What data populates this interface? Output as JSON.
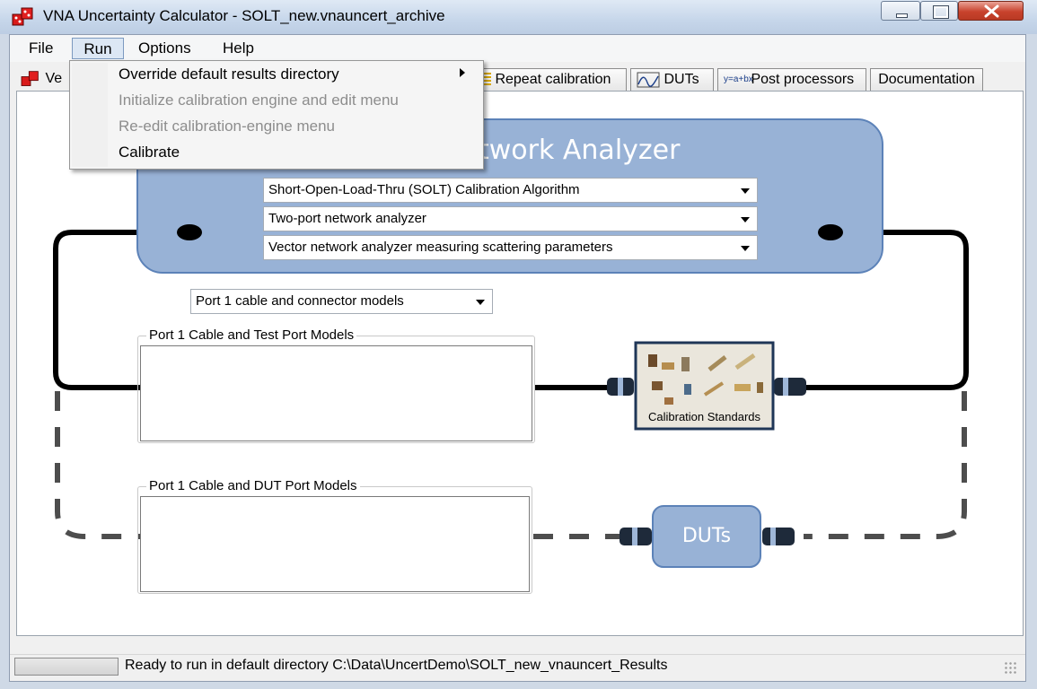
{
  "window": {
    "title": "VNA Uncertainty Calculator - SOLT_new.vnauncert_archive"
  },
  "menubar": {
    "items": [
      "File",
      "Run",
      "Options",
      "Help"
    ]
  },
  "run_menu": {
    "items": [
      {
        "label": "Override default results directory",
        "enabled": true,
        "submenu": true
      },
      {
        "label": "Initialize calibration engine and edit menu",
        "enabled": false
      },
      {
        "label": "Re-edit calibration-engine menu",
        "enabled": false
      },
      {
        "label": "Calibrate",
        "enabled": true
      }
    ]
  },
  "tabs": {
    "first_partial": "Ve",
    "items": [
      "Repeat calibration",
      "DUTs",
      "Post processors",
      "Documentation"
    ],
    "post_processors_icon": "y=a+bx"
  },
  "diagram": {
    "analyzer_title": "twork Analyzer",
    "combo_algorithm": "Short-Open-Load-Thru (SOLT) Calibration Algorithm",
    "combo_ports": "Two-port network analyzer",
    "combo_type": "Vector network analyzer measuring scattering parameters",
    "combo_port1": "Port 1 cable and connector models",
    "group1_label": "Port 1 Cable and Test Port Models",
    "group2_label": "Port 1 Cable and DUT Port Models",
    "cal_standards_label": "Calibration Standards",
    "duts_label": "DUTs"
  },
  "status": {
    "text": "Ready to run in default directory C:\\Data\\UncertDemo\\SOLT_new_vnauncert_Results"
  },
  "colors": {
    "analyzer_fill": "#98b2d6",
    "analyzer_border": "#5c82b8",
    "cable": "#000000",
    "dashed_cable": "#4d4d4d"
  }
}
